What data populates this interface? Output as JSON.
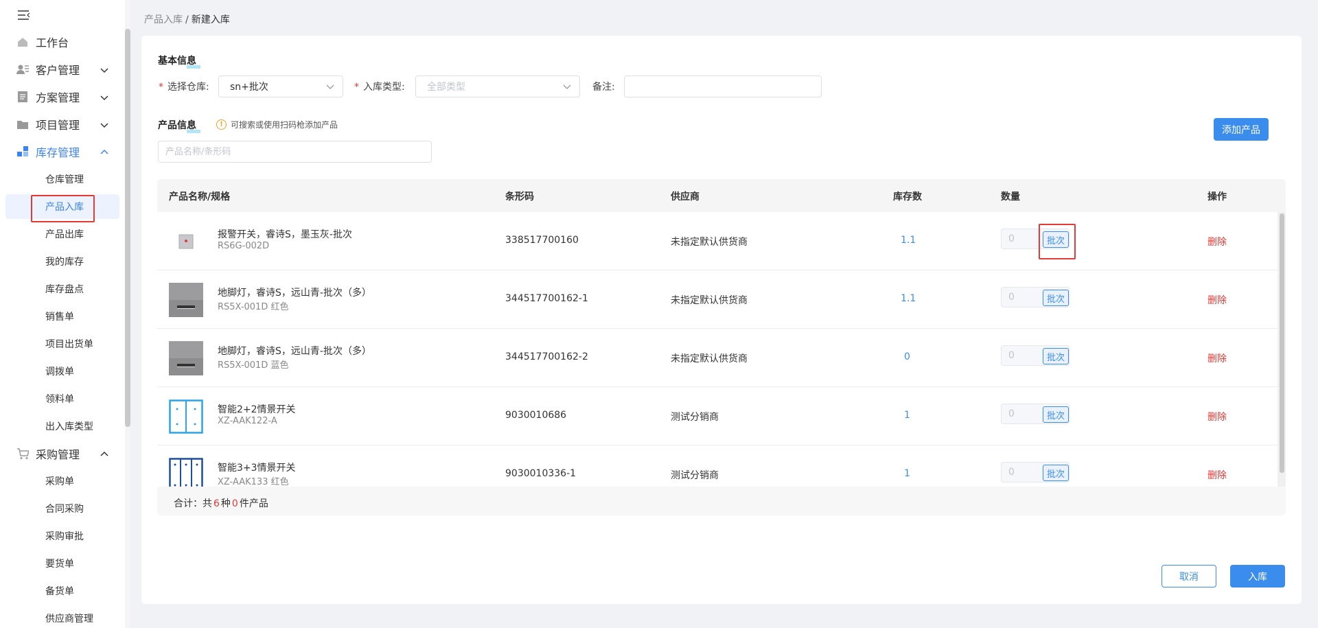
{
  "breadcrumb": {
    "parent": "产品入库",
    "separator": "/",
    "current": "新建入库"
  },
  "sidebar": {
    "menu": [
      {
        "label": "工作台",
        "icon": "home-icon"
      },
      {
        "label": "客户管理",
        "icon": "customer-icon"
      },
      {
        "label": "方案管理",
        "icon": "document-icon"
      },
      {
        "label": "项目管理",
        "icon": "folder-icon"
      },
      {
        "label": "库存管理",
        "icon": "inventory-icon"
      },
      {
        "label": "采购管理",
        "icon": "cart-icon"
      }
    ],
    "inventory_sub": [
      "仓库管理",
      "产品入库",
      "产品出库",
      "我的库存",
      "库存盘点",
      "销售单",
      "项目出货单",
      "调拨单",
      "领料单",
      "出入库类型"
    ],
    "purchase_sub": [
      "采购单",
      "合同采购",
      "采购审批",
      "要货单",
      "备货单",
      "供应商管理"
    ]
  },
  "basic": {
    "title": "基本信息",
    "warehouse_label": "选择仓库:",
    "warehouse_value": "sn+批次",
    "type_label": "入库类型:",
    "type_placeholder": "全部类型",
    "remark_label": "备注:",
    "remark_value": ""
  },
  "product_info": {
    "title": "产品信息",
    "hint": "可搜索或使用扫码枪添加产品",
    "search_placeholder": "产品名称/条形码",
    "add_button": "添加产品"
  },
  "table": {
    "headers": [
      "产品名称/规格",
      "条形码",
      "供应商",
      "库存数",
      "数量",
      "操作"
    ],
    "rows": [
      {
        "name": "报警开关，睿诗S，墨玉灰-批次",
        "spec": "RS6G-002D",
        "barcode": "338517700160",
        "supplier": "未指定默认供货商",
        "stock": "1.1",
        "qty": "0",
        "batch": "批次",
        "action": "删除"
      },
      {
        "name": "地脚灯，睿诗S，远山青-批次（多）",
        "spec": "RS5X-001D 红色",
        "barcode": "344517700162-1",
        "supplier": "未指定默认供货商",
        "stock": "1.1",
        "qty": "0",
        "batch": "批次",
        "action": "删除"
      },
      {
        "name": "地脚灯，睿诗S，远山青-批次（多）",
        "spec": "RS5X-001D 蓝色",
        "barcode": "344517700162-2",
        "supplier": "未指定默认供货商",
        "stock": "0",
        "qty": "0",
        "batch": "批次",
        "action": "删除"
      },
      {
        "name": "智能2+2情景开关",
        "spec": "XZ-AAK122-A",
        "barcode": "9030010686",
        "supplier": "测试分销商",
        "stock": "1",
        "qty": "0",
        "batch": "批次",
        "action": "删除"
      },
      {
        "name": "智能3+3情景开关",
        "spec": "XZ-AAK133 红色",
        "barcode": "9030010336-1",
        "supplier": "测试分销商",
        "stock": "1",
        "qty": "0",
        "batch": "批次",
        "action": "删除"
      }
    ],
    "footer": {
      "prefix": "合计：共",
      "kinds": "6",
      "mid": "种",
      "count": "0",
      "suffix": "件产品"
    }
  },
  "actions": {
    "cancel": "取消",
    "submit": "入库"
  },
  "colors": {
    "primary": "#3b8ded",
    "danger": "#e53935",
    "active_bg": "#ecf3fe"
  }
}
